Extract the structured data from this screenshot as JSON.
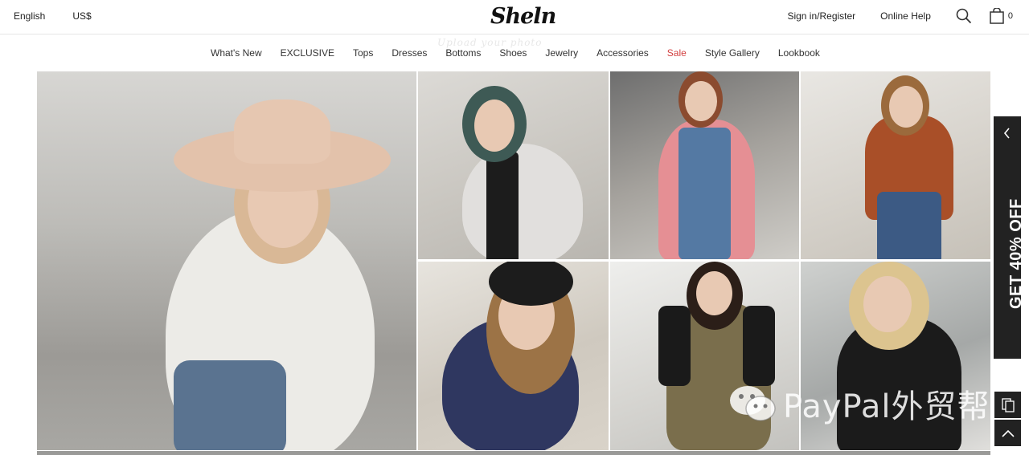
{
  "topbar": {
    "language": "English",
    "currency": "US$",
    "brand": "Sheln",
    "sign_in": "Sign in/Register",
    "help": "Online Help",
    "bag_count": "0"
  },
  "nav": {
    "ghost_text": "Upload your photo",
    "items": [
      "What's New",
      "EXCLUSIVE",
      "Tops",
      "Dresses",
      "Bottoms",
      "Shoes",
      "Jewelry",
      "Accessories",
      "Sale",
      "Style Gallery",
      "Lookbook"
    ]
  },
  "promo": {
    "label": "GET 40% OFF"
  },
  "watermark": {
    "text": "PayPal外贸帮"
  },
  "colors": {
    "sale": "#d23f3f",
    "promo_bg": "#222222"
  },
  "icons": [
    "search-icon",
    "shopping-bag-icon",
    "chevron-left-icon",
    "copy-icon",
    "chevron-up-icon",
    "wechat-icon"
  ]
}
